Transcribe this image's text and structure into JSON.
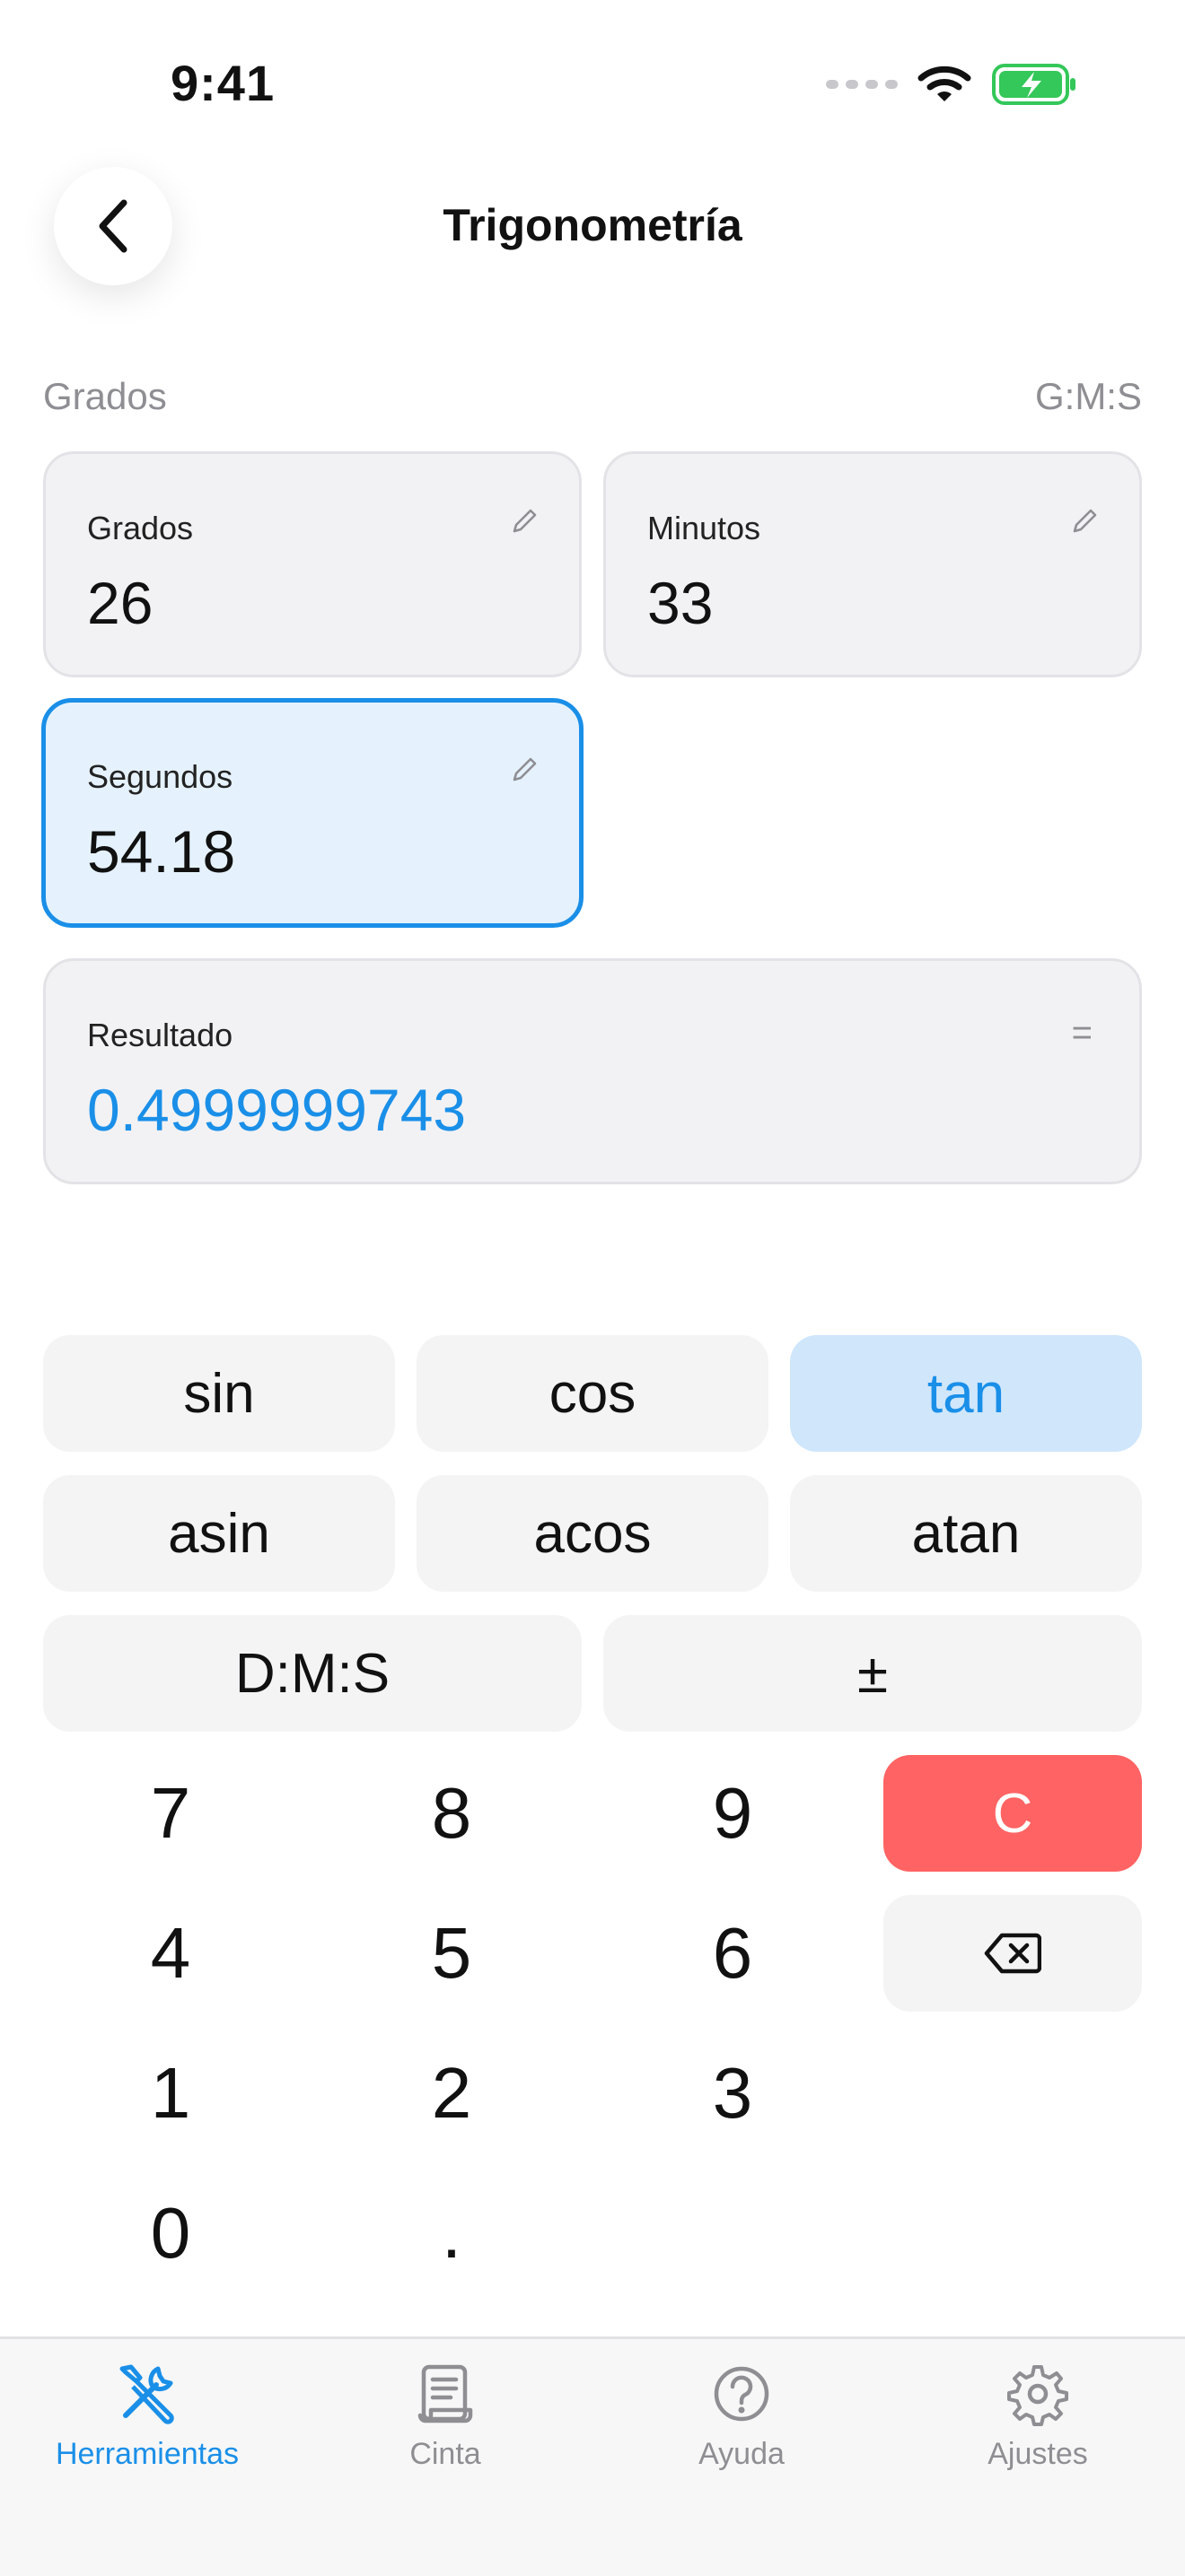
{
  "status_bar": {
    "time": "9:41"
  },
  "header": {
    "title": "Trigonometría"
  },
  "mode": {
    "left_label": "Grados",
    "right_label": "G:M:S"
  },
  "inputs": {
    "degrees": {
      "label": "Grados",
      "value": "26"
    },
    "minutes": {
      "label": "Minutos",
      "value": "33"
    },
    "seconds": {
      "label": "Segundos",
      "value": "54.18"
    }
  },
  "result": {
    "label": "Resultado",
    "value": "0.4999999743",
    "symbol": "="
  },
  "functions": {
    "row1": [
      "sin",
      "cos",
      "tan"
    ],
    "row2": [
      "asin",
      "acos",
      "atan"
    ],
    "dms_label": "D:M:S",
    "sign_label": "±",
    "selected": "tan"
  },
  "keypad": {
    "seven": "7",
    "eight": "8",
    "nine": "9",
    "four": "4",
    "five": "5",
    "six": "6",
    "one": "1",
    "two": "2",
    "three": "3",
    "zero": "0",
    "decimal": ".",
    "clear_label": "C"
  },
  "tabs": [
    {
      "label": "Herramientas",
      "icon": "tools-icon",
      "active": true
    },
    {
      "label": "Cinta",
      "icon": "scroll-icon",
      "active": false
    },
    {
      "label": "Ayuda",
      "icon": "help-icon",
      "active": false
    },
    {
      "label": "Ajustes",
      "icon": "gear-icon",
      "active": false
    }
  ],
  "colors": {
    "accent": "#1a8fe8",
    "clear": "#ff6363",
    "battery": "#34c759",
    "selected_bg": "#cfe6fb"
  }
}
